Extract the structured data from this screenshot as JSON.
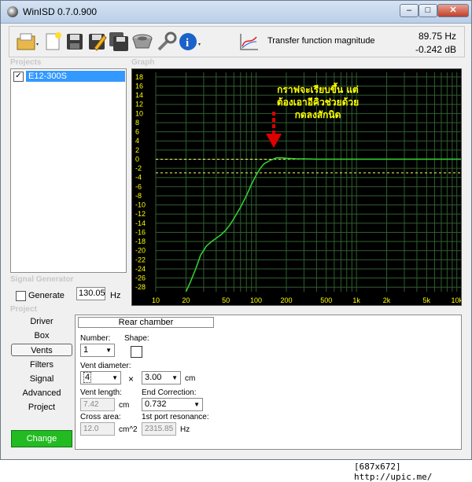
{
  "window": {
    "title": "WinISD 0.7.0.900"
  },
  "toolbar": {
    "graph_name": "Transfer function magnitude",
    "freq_readout": "89.75 Hz",
    "db_readout": "-0.242 dB"
  },
  "sections": {
    "projects": "Projects",
    "graph": "Graph",
    "signal_generator": "Signal Generator",
    "project": "Project"
  },
  "projects": [
    {
      "name": "E12-300S",
      "checked": true
    }
  ],
  "graph": {
    "y_ticks": [
      "18",
      "16",
      "14",
      "12",
      "10",
      "8",
      "6",
      "4",
      "2",
      "0",
      "-2",
      "-4",
      "-6",
      "-8",
      "-10",
      "-12",
      "-14",
      "-16",
      "-18",
      "-20",
      "-22",
      "-24",
      "-26",
      "-28"
    ],
    "x_ticks": [
      "10",
      "20",
      "50",
      "100",
      "200",
      "500",
      "1k",
      "2k",
      "5k",
      "10k"
    ],
    "annotation_lines": [
      "กราฟจะเรียบขึ้น แต่",
      "ต้องเอาอีคิวช่วยด้วย",
      "กดลงสักนิด"
    ],
    "colors": {
      "curve": "#33cc33",
      "grid": "#2f5f2f",
      "annotation": "#ffff00",
      "arrow": "#dd0000",
      "ref_line": "#ffff66"
    }
  },
  "chart_data": {
    "type": "line",
    "x_scale": "log",
    "xlim": [
      10,
      11000
    ],
    "ylim": [
      -29,
      19
    ],
    "series": [
      {
        "x": [
          20,
          22,
          25,
          28,
          32,
          36,
          40,
          45,
          50,
          55,
          60,
          70,
          80,
          90,
          100,
          110,
          120,
          140,
          160,
          180,
          200,
          250,
          300,
          400,
          500,
          1000,
          2000,
          5000,
          11000
        ],
        "y": [
          -29,
          -27,
          -24,
          -21,
          -19,
          -18,
          -17.3,
          -16.5,
          -15.5,
          -14.3,
          -13,
          -10.5,
          -8,
          -5.5,
          -3.5,
          -2,
          -1,
          -0.2,
          0.3,
          0.3,
          0.2,
          0.1,
          0.05,
          0,
          0,
          0,
          0,
          0,
          0
        ]
      }
    ]
  },
  "signal_generator": {
    "generate_label": "Generate",
    "generate_checked": false,
    "frequency": "130.05",
    "unit": "Hz"
  },
  "project_nav": {
    "items": [
      "Driver",
      "Box",
      "Vents",
      "Filters",
      "Signal",
      "Advanced",
      "Project"
    ],
    "active": "Vents",
    "change_label": "Change"
  },
  "vents_panel": {
    "header": "Rear chamber",
    "number_label": "Number:",
    "number_value": "1",
    "shape_label": "Shape:",
    "diameter_label": "Vent diameter:",
    "diameter_value": "4",
    "times": "×",
    "diameter_value2": "3.00",
    "diameter_unit": "cm",
    "length_label": "Vent length:",
    "length_value": "7.42",
    "length_unit": "cm",
    "end_corr_label": "End Correction:",
    "end_corr_value": "0.732",
    "cross_area_label": "Cross area:",
    "cross_area_value": "12.0",
    "cross_area_unit": "cm^2",
    "resonance_label": "1st port resonance:",
    "resonance_value": "2315.85",
    "resonance_unit": "Hz"
  },
  "footer": {
    "watermark": "[687x672] http://upic.me/"
  }
}
